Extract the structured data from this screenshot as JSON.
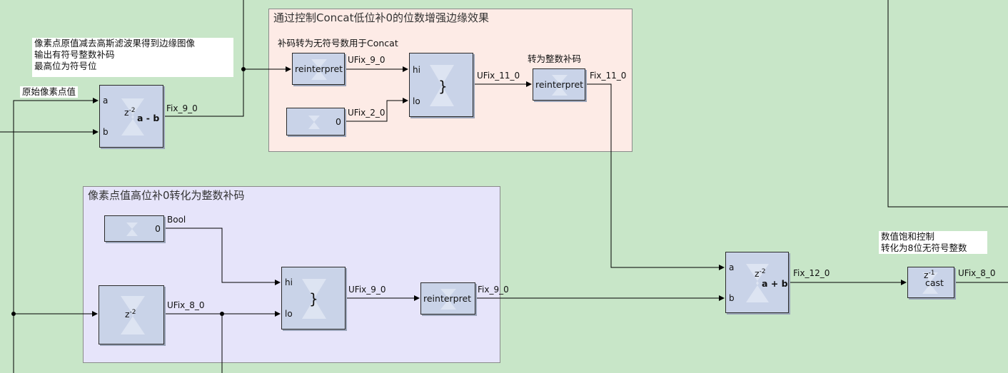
{
  "areas": {
    "concat_title": "通过控制Concat低位补0的位数增强边缘效果",
    "pad_title": "像素点值高位补0转化为整数补码"
  },
  "notes": {
    "edge_note": "像素点原值减去高斯滤波果得到边缘图像\n输出有符号整数补码\n最高位为符号位",
    "orig_label": "原始像素点值",
    "reinterp_note": "补码转为无符号数用于Concat",
    "to_int_note": "转为整数补码",
    "saturate_note": "数值饱和控制\n转化为8位无符号整数"
  },
  "blocks": {
    "sub": {
      "port_a": "a",
      "port_b": "b",
      "delay": "z",
      "delay_exp": "-2",
      "op": "a - b"
    },
    "reinterpret1": {
      "label": "reinterpret"
    },
    "const_lo": {
      "value": "0"
    },
    "concat1": {
      "port_hi": "hi",
      "port_lo": "lo",
      "symbol": "}"
    },
    "reinterpret2": {
      "label": "reinterpret"
    },
    "const_bool": {
      "value": "0"
    },
    "delay": {
      "delay": "z",
      "delay_exp": "-2"
    },
    "concat2": {
      "port_hi": "hi",
      "port_lo": "lo",
      "symbol": "}"
    },
    "reinterpret3": {
      "label": "reinterpret"
    },
    "add": {
      "port_a": "a",
      "port_b": "b",
      "delay": "z",
      "delay_exp": "-2",
      "op": "a + b"
    },
    "cast": {
      "delay": "z",
      "delay_exp": "-1",
      "op": "cast"
    }
  },
  "signals": {
    "sub_out": "Fix_9_0",
    "r1_out": "UFix_9_0",
    "const_lo_out": "UFix_2_0",
    "concat1_out": "UFix_11_0",
    "r2_out": "Fix_11_0",
    "bool_out": "Bool",
    "delay_out": "UFix_8_0",
    "concat2_out": "UFix_9_0",
    "r3_out": "Fix_9_0",
    "add_out": "Fix_12_0",
    "cast_out": "UFix_8_0"
  },
  "colors": {
    "background": "#c8e6c8",
    "block": "#c9d3e8",
    "concat_area": "#fdebe6",
    "pad_area": "#e6e4fa"
  }
}
